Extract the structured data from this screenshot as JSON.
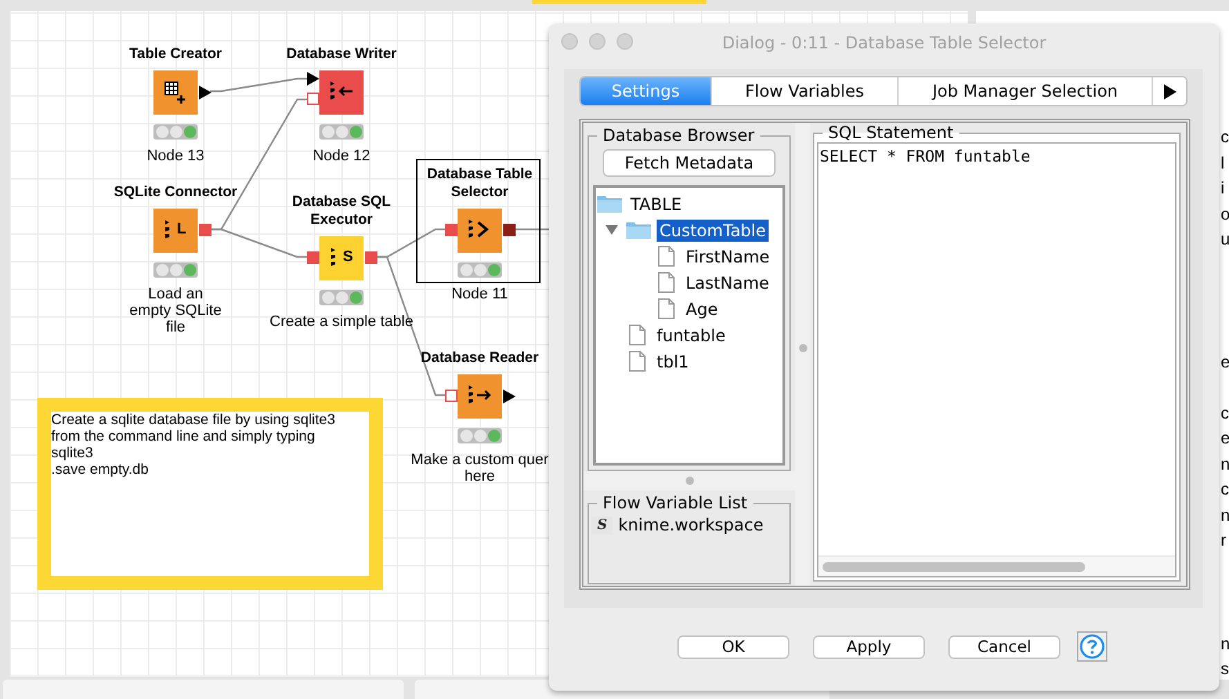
{
  "workflow": {
    "nodes": [
      {
        "title": "Table Creator",
        "kind": "table_creator",
        "color": "#f0922e",
        "caption": "Node 13",
        "executed": true,
        "selected": false,
        "outputs": [
          {
            "kind": "data"
          }
        ]
      },
      {
        "title": "Database Writer",
        "kind": "db_writer",
        "color": "#ea4b4b",
        "caption": "Node 12",
        "executed": true,
        "selected": false,
        "inputs": [
          {
            "kind": "data"
          },
          {
            "kind": "db_outline"
          }
        ]
      },
      {
        "title": "SQLite Connector",
        "kind": "db_connector",
        "glyph": "L",
        "color": "#f0922e",
        "caption": "Load an\nempty SQLite\nfile",
        "executed": true,
        "selected": false,
        "outputs": [
          {
            "kind": "db"
          }
        ]
      },
      {
        "title": "Database SQL\nExecutor",
        "kind": "sql_executor",
        "glyph": "S",
        "color": "#fbd22f",
        "caption": "Create a simple table",
        "executed": true,
        "selected": false,
        "inputs": [
          {
            "kind": "db"
          }
        ],
        "outputs": [
          {
            "kind": "db"
          }
        ]
      },
      {
        "title": "Database Table\nSelector",
        "kind": "db_selector",
        "color": "#f0922e",
        "caption": "Node 11",
        "executed": true,
        "selected": true,
        "inputs": [
          {
            "kind": "db"
          }
        ],
        "outputs": [
          {
            "kind": "db_dark"
          }
        ]
      },
      {
        "title": "Database Reader",
        "kind": "db_reader",
        "color": "#f0922e",
        "caption": "Make a custom quer\nhere",
        "executed": true,
        "selected": false,
        "inputs": [
          {
            "kind": "db_outline"
          }
        ],
        "outputs": [
          {
            "kind": "data"
          }
        ]
      }
    ],
    "annotation": "Create a sqlite database file by using sqlite3\nfrom the command line and simply typing\nsqlite3\n.save empty.db"
  },
  "dialog": {
    "title": "Dialog - 0:11 - Database Table Selector",
    "tabs": [
      {
        "label": "Settings",
        "selected": true
      },
      {
        "label": "Flow Variables",
        "selected": false
      },
      {
        "label": "Job Manager Selection",
        "selected": false
      }
    ],
    "database_browser": {
      "title": "Database Browser",
      "button": "Fetch Metadata",
      "tree": [
        {
          "label": "TABLE",
          "kind": "folder",
          "selected": false,
          "children": [
            {
              "label": "CustomTable",
              "kind": "folder",
              "selected": true,
              "expanded": true,
              "children": [
                {
                  "label": "FirstName",
                  "kind": "file",
                  "selected": false
                },
                {
                  "label": "LastName",
                  "kind": "file",
                  "selected": false
                },
                {
                  "label": "Age",
                  "kind": "file",
                  "selected": false
                }
              ]
            },
            {
              "label": "funtable",
              "kind": "file",
              "selected": false
            },
            {
              "label": "tbl1",
              "kind": "file",
              "selected": false
            }
          ]
        }
      ]
    },
    "flow_variable_list": {
      "title": "Flow Variable List",
      "items": [
        {
          "type": "S",
          "name": "knime.workspace"
        }
      ]
    },
    "sql_statement": {
      "title": "SQL Statement",
      "value": "SELECT * FROM funtable"
    },
    "buttons": [
      "OK",
      "Apply",
      "Cancel"
    ]
  },
  "side_panel": {
    "groups": [
      [
        "c",
        "l",
        "i",
        "o",
        "u"
      ],
      [
        "e"
      ],
      [
        "c",
        "e",
        "n",
        "c",
        "n",
        "r"
      ],
      [
        "n",
        "s"
      ]
    ]
  }
}
